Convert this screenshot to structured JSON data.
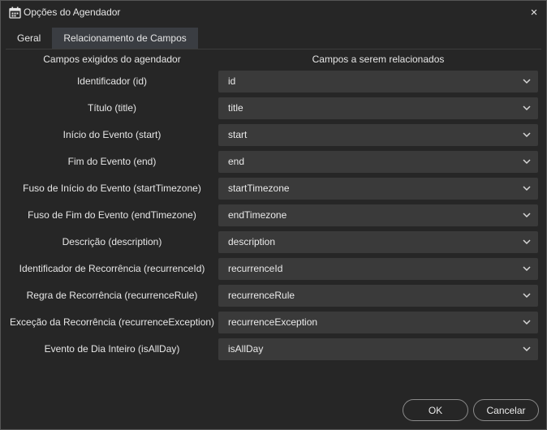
{
  "window": {
    "title": "Opções do Agendador",
    "close_glyph": "×",
    "icon": "calendar-icon"
  },
  "tabs": [
    {
      "label": "Geral",
      "active": false
    },
    {
      "label": "Relacionamento de Campos",
      "active": true
    }
  ],
  "headers": {
    "left": "Campos exigidos do agendador",
    "right": "Campos a serem relacionados"
  },
  "rows": [
    {
      "label": "Identificador (id)",
      "value": "id"
    },
    {
      "label": "Título (title)",
      "value": "title"
    },
    {
      "label": "Início do Evento (start)",
      "value": "start"
    },
    {
      "label": "Fim do Evento (end)",
      "value": "end"
    },
    {
      "label": "Fuso de Início do Evento (startTimezone)",
      "value": "startTimezone"
    },
    {
      "label": "Fuso de Fim do Evento (endTimezone)",
      "value": "endTimezone"
    },
    {
      "label": "Descrição (description)",
      "value": "description"
    },
    {
      "label": "Identificador de Recorrência (recurrenceId)",
      "value": "recurrenceId"
    },
    {
      "label": "Regra de Recorrência (recurrenceRule)",
      "value": "recurrenceRule"
    },
    {
      "label": "Exceção da Recorrência (recurrenceException)",
      "value": "recurrenceException"
    },
    {
      "label": "Evento de Dia Inteiro (isAllDay)",
      "value": "isAllDay"
    }
  ],
  "buttons": {
    "ok": "OK",
    "cancel": "Cancelar"
  },
  "colors": {
    "background": "#262626",
    "select_bg": "#3a3a3a",
    "active_tab": "#3a3d42"
  }
}
